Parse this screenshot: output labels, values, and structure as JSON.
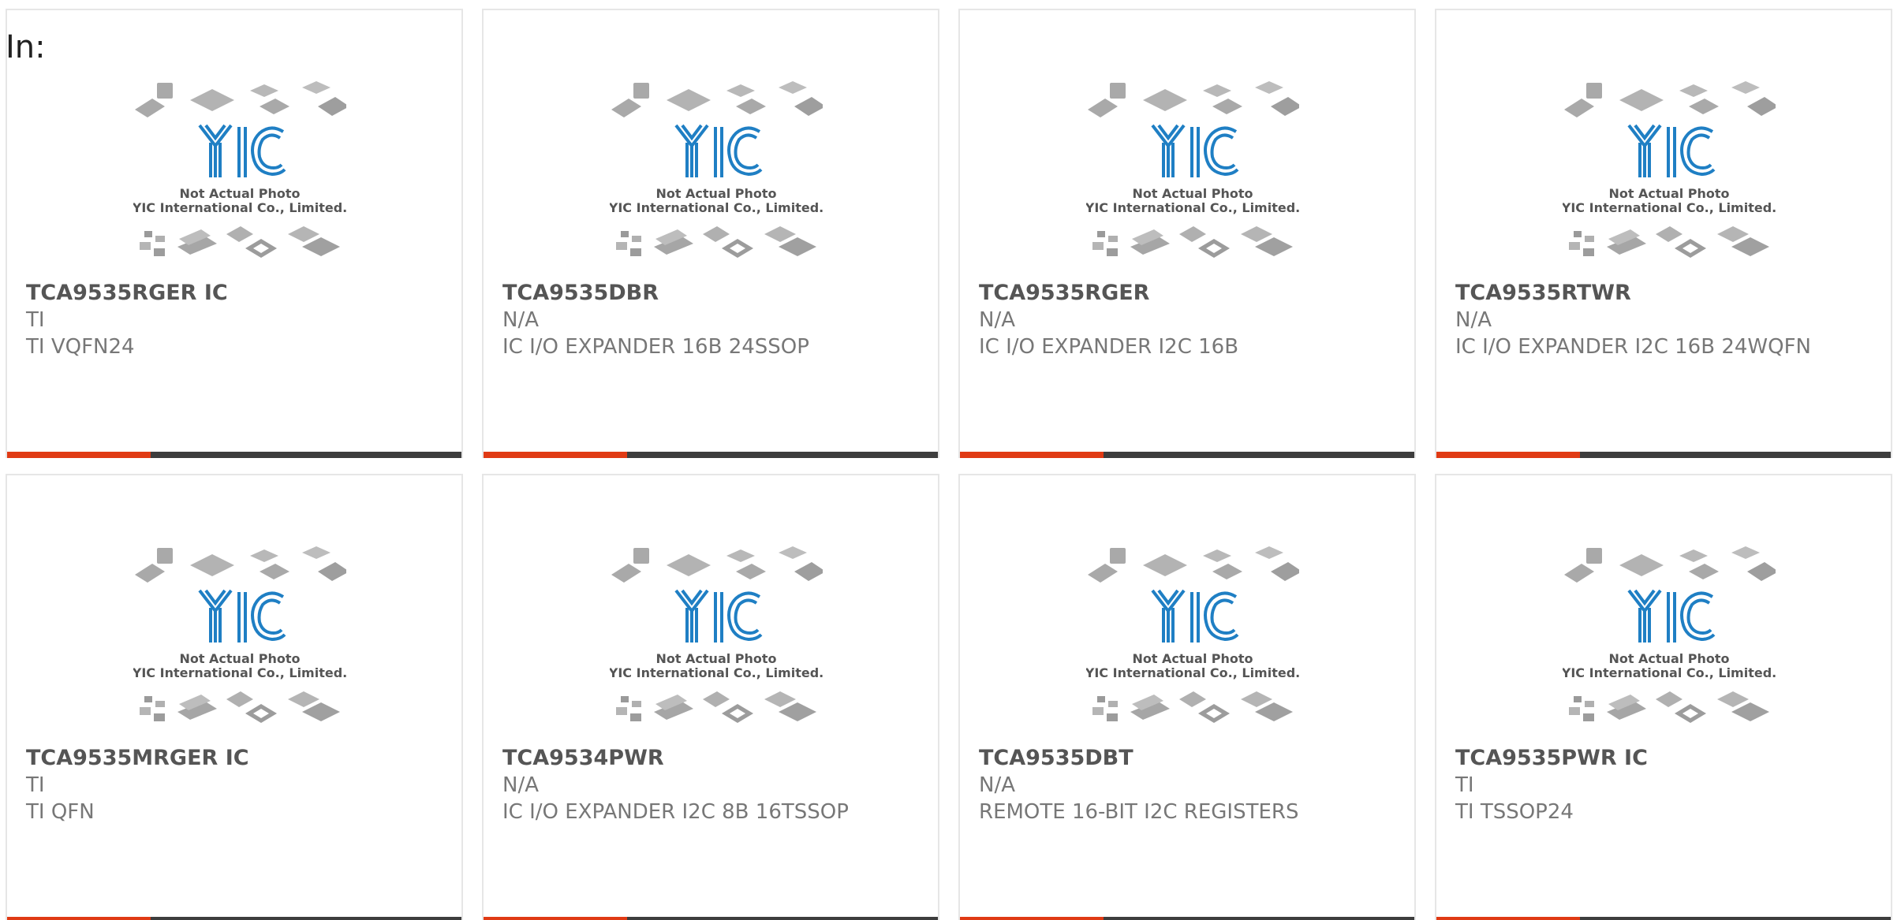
{
  "header": {
    "label": "In:"
  },
  "placeholder": {
    "logo_text": "YIC",
    "line1": "Not Actual Photo",
    "line2": "YIC International Co., Limited."
  },
  "colors": {
    "accent": "#e03a14",
    "bar": "#3d3d3d",
    "logo": "#1f7fc4"
  },
  "products": [
    {
      "part": "TCA9535RGER IC",
      "manufacturer": "TI",
      "description": "TI VQFN24"
    },
    {
      "part": "TCA9535DBR",
      "manufacturer": "N/A",
      "description": "IC I/O EXPANDER 16B 24SSOP"
    },
    {
      "part": "TCA9535RGER",
      "manufacturer": "N/A",
      "description": "IC I/O EXPANDER I2C 16B"
    },
    {
      "part": "TCA9535RTWR",
      "manufacturer": "N/A",
      "description": "IC I/O EXPANDER I2C 16B 24WQFN"
    },
    {
      "part": "TCA9535MRGER IC",
      "manufacturer": "TI",
      "description": "TI QFN"
    },
    {
      "part": "TCA9534PWR",
      "manufacturer": "N/A",
      "description": "IC I/O EXPANDER I2C 8B 16TSSOP"
    },
    {
      "part": "TCA9535DBT",
      "manufacturer": "N/A",
      "description": "REMOTE 16-BIT I2C REGISTERS"
    },
    {
      "part": "TCA9535PWR IC",
      "manufacturer": "TI",
      "description": "TI TSSOP24"
    }
  ]
}
